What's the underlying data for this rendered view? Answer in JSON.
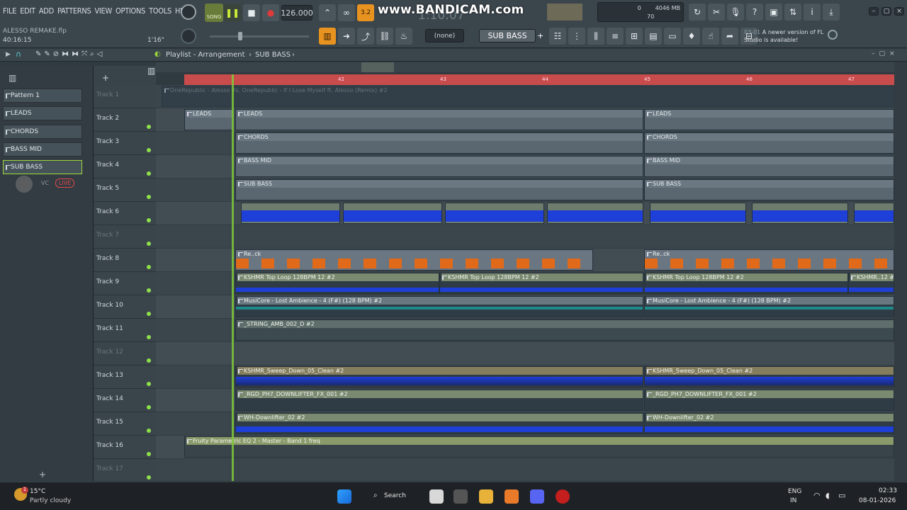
{
  "menu": [
    "FILE",
    "EDIT",
    "ADD",
    "PATTERNS",
    "VIEW",
    "OPTIONS",
    "TOOLS",
    "HELP"
  ],
  "transport": {
    "song_label": "SONG",
    "tempo": "126.000",
    "time": "1:10:07",
    "beat": "70"
  },
  "project": {
    "name": "ALESSO REMAKE.flp",
    "time": "40:16:15",
    "duration": "1'16\""
  },
  "watermark": "www.BANDICAM.com",
  "memory": {
    "value": "0",
    "mb": "4046 MB"
  },
  "toolbar": {
    "channel_selector": "(none)",
    "current_pattern": "SUB BASS"
  },
  "update": {
    "date": "03-01",
    "text": "A newer version of FL Studio is available!"
  },
  "playlist": {
    "title": "Playlist - Arrangement",
    "pattern": "SUB BASS",
    "ruler": [
      "42",
      "43",
      "44",
      "45",
      "46",
      "47"
    ]
  },
  "patterns": [
    "Pattern 1",
    "LEADS",
    "CHORDS",
    "BASS MID",
    "SUB BASS"
  ],
  "live": {
    "vc": "VC",
    "live": "LIVE"
  },
  "tracks": [
    "Track 1",
    "Track 2",
    "Track 3",
    "Track 4",
    "Track 5",
    "Track 6",
    "Track 7",
    "Track 8",
    "Track 9",
    "Track 10",
    "Track 11",
    "Track 12",
    "Track 13",
    "Track 14",
    "Track 15",
    "Track 16",
    "Track 17"
  ],
  "clips": {
    "t1": "OneRepublic - Alesso Vs. OneRepublic - If I Lose Myself ft. Alesso (Remix) #2",
    "leads": "LEADS",
    "chords": "CHORDS",
    "bassmid": "BASS MID",
    "subbass": "SUB BASS",
    "rech": "Re..ck",
    "t9": "KSHMR Top Loop 128BPM 12 #2",
    "t9b": "KSHMR..12 #2",
    "t10": "MusiCore - Lost Ambience - 4 (F#) (128 BPM) #2",
    "t11": "_STRING_AMB_002_D #2",
    "t13": "KSHMR_Sweep_Down_05_Clean #2",
    "t14": "_RGD_PH7_DOWNLIFTER_FX_001 #2",
    "t15": "WH-Downlifter_02 #2",
    "t16": "Fruity Parametric EQ 2 - Master - Band 1 freq"
  },
  "taskbar": {
    "temp": "15°C",
    "weather": "Partly cloudy",
    "search": "Search",
    "lang1": "ENG",
    "lang2": "IN",
    "clock": "02:33",
    "date": "08-01-2026",
    "badge": "1"
  },
  "colors": {
    "accent": "#e8931f",
    "playhead": "#7fc93a",
    "ruler": "#c94c4c",
    "audio_wave": "#1e3fd8",
    "orange_clip": "#e06a1a"
  }
}
